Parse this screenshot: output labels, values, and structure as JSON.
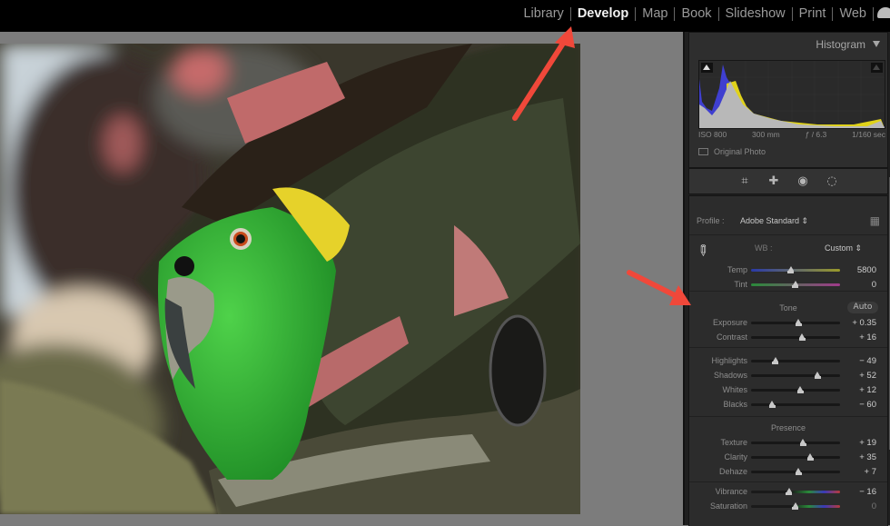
{
  "modules": [
    {
      "label": "Library",
      "active": false
    },
    {
      "label": "Develop",
      "active": true
    },
    {
      "label": "Map",
      "active": false
    },
    {
      "label": "Book",
      "active": false
    },
    {
      "label": "Slideshow",
      "active": false
    },
    {
      "label": "Print",
      "active": false
    },
    {
      "label": "Web",
      "active": false
    }
  ],
  "histogram": {
    "title": "Histogram",
    "iso": "ISO 800",
    "focal": "300 mm",
    "aperture": "ƒ / 6.3",
    "shutter": "1/160 sec",
    "original_photo_label": "Original Photo",
    "colors": {
      "blue": "#3f3fd0",
      "yellow": "#e0d21a",
      "gray": "#b5b5b5",
      "red": "#c83a2a",
      "green": "#2a9a3a",
      "cyan": "#3aa8d8"
    }
  },
  "tools": [
    "crop-icon",
    "healing-icon",
    "redeye-icon",
    "masking-icon"
  ],
  "basic": {
    "profile_label": "Profile :",
    "profile_value": "Adobe Standard ⇕",
    "wb_label": "WB :",
    "wb_value": "Custom ⇕",
    "tone_label": "Tone",
    "auto_label": "Auto",
    "presence_label": "Presence",
    "wb_sliders": [
      {
        "label": "Temp",
        "value": "5800",
        "pos": 0.45,
        "dim": false
      },
      {
        "label": "Tint",
        "value": "0",
        "pos": 0.5,
        "dim": false
      }
    ],
    "tone_sliders": [
      {
        "label": "Exposure",
        "value": "+ 0.35",
        "pos": 0.54
      },
      {
        "label": "Contrast",
        "value": "+ 16",
        "pos": 0.58
      }
    ],
    "tone2_sliders": [
      {
        "label": "Highlights",
        "value": "− 49",
        "pos": 0.28
      },
      {
        "label": "Shadows",
        "value": "+ 52",
        "pos": 0.75
      },
      {
        "label": "Whites",
        "value": "+ 12",
        "pos": 0.56
      },
      {
        "label": "Blacks",
        "value": "− 60",
        "pos": 0.24
      }
    ],
    "presence_sliders": [
      {
        "label": "Texture",
        "value": "+ 19",
        "pos": 0.59
      },
      {
        "label": "Clarity",
        "value": "+ 35",
        "pos": 0.67
      },
      {
        "label": "Dehaze",
        "value": "+ 7",
        "pos": 0.54
      }
    ],
    "color_sliders": [
      {
        "label": "Vibrance",
        "value": "− 16",
        "pos": 0.43
      },
      {
        "label": "Saturation",
        "value": "0",
        "pos": 0.5,
        "dim": true
      }
    ]
  },
  "annotations": {
    "arrow_color": "#f0483a"
  }
}
